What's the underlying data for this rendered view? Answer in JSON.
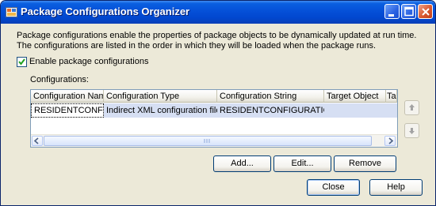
{
  "window": {
    "title": "Package Configurations Organizer",
    "icons": [
      "app-icon",
      "minimize-icon",
      "maximize-icon",
      "close-icon"
    ]
  },
  "description": "Package configurations enable the properties of package objects to be dynamically updated at run time. The configurations are listed in the order in which they will be loaded when the package runs.",
  "enable_checkbox": {
    "label": "Enable package configurations",
    "checked": true
  },
  "configurations_label": "Configurations:",
  "grid": {
    "columns": [
      "Configuration Name",
      "Configuration Type",
      "Configuration String",
      "Target Object",
      "Tar"
    ],
    "rows": [
      [
        "RESIDENTCONFIG",
        "Indirect XML configuration file",
        "RESIDENTCONFIGURATION",
        "",
        ""
      ]
    ]
  },
  "move_buttons": {
    "up_icon": "arrow-up-icon",
    "down_icon": "arrow-down-icon"
  },
  "buttons": {
    "add": "Add...",
    "edit": "Edit...",
    "remove": "Remove",
    "close": "Close",
    "help": "Help"
  },
  "colors": {
    "title_bar": "#0550d8",
    "dialog_bg": "#ece9d8",
    "selection": "#d6dff3",
    "check": "#21a121"
  }
}
